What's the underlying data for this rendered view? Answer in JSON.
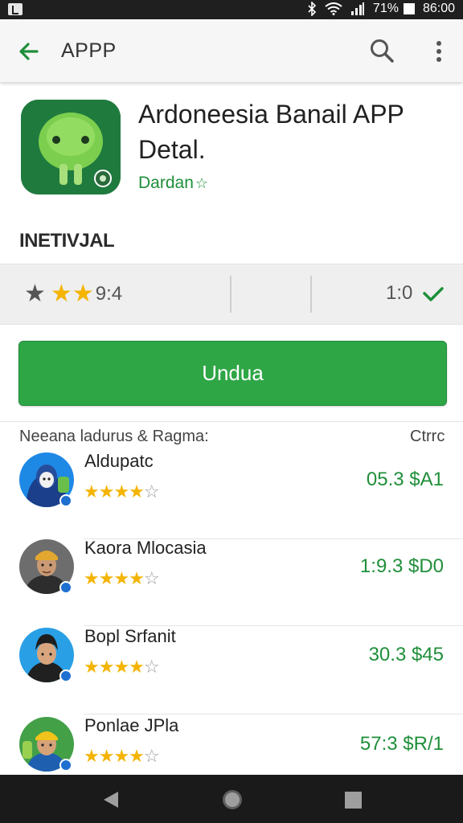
{
  "status_bar": {
    "battery": "71%",
    "time": "86:00"
  },
  "app_bar": {
    "title": "APPP"
  },
  "app": {
    "title_line1": "Ardoneesia Banail APP",
    "title_line2": "Detal.",
    "developer": "Dardan"
  },
  "section_title": "INETIVJAL",
  "rating": {
    "value": "9:4",
    "count": "1:0"
  },
  "install_button": {
    "label": "Undua"
  },
  "list_header": {
    "left": "Neeana ladurus & Ragma:",
    "right": "Ctrrc"
  },
  "reviews": [
    {
      "name": "Aldupatc",
      "rating": 4,
      "value": "05.3 $A1",
      "avatar": "avatar-1"
    },
    {
      "name": "Kaora Mlocasia",
      "rating": 4,
      "value": "1:9.3 $D0",
      "avatar": "avatar-2"
    },
    {
      "name": "Bopl Srfanit",
      "rating": 4,
      "value": "30.3 $45",
      "avatar": "avatar-3"
    },
    {
      "name": "Ponlae JPla",
      "rating": 4,
      "value": "57:3 $R/1",
      "avatar": "avatar-4"
    }
  ],
  "icons": [
    "back-arrow-icon",
    "search-icon",
    "more-vert-icon",
    "star-icon",
    "check-icon",
    "bluetooth-icon",
    "wifi-icon",
    "signal-icon",
    "battery-icon"
  ],
  "colors": {
    "accent": "#2ea646",
    "star": "#f4b400",
    "green_text": "#1f8f3a"
  }
}
